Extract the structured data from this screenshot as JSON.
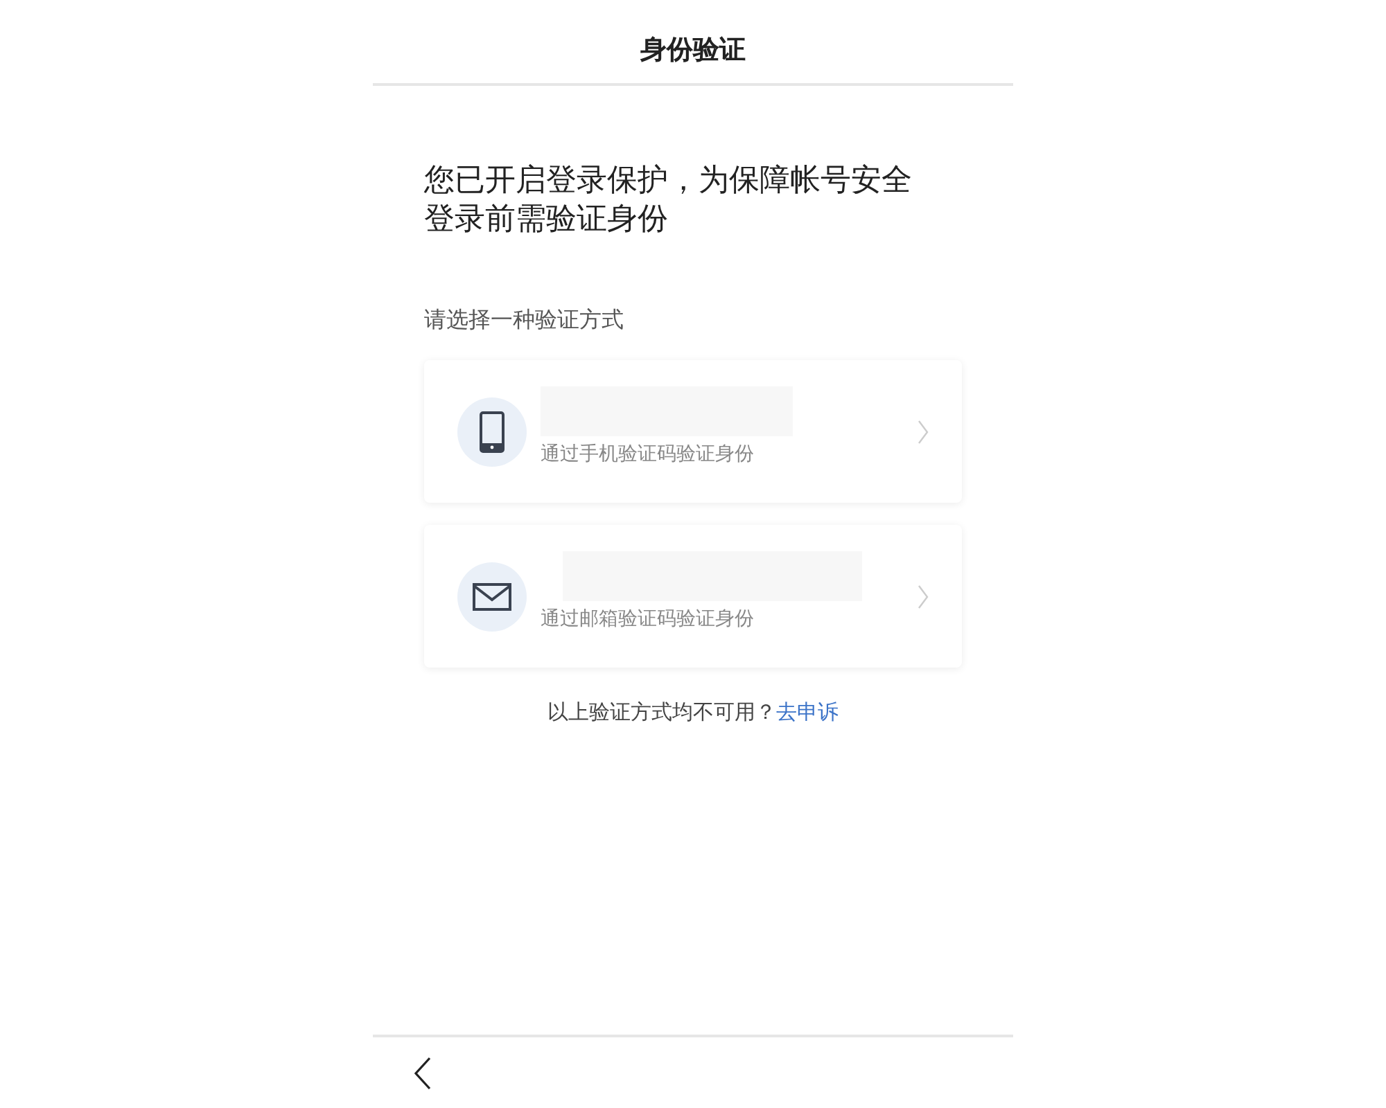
{
  "header": {
    "title": "身份验证"
  },
  "intro": [
    "您已开启登录保护，为保障帐号安全",
    "登录前需验证身份"
  ],
  "prompt": "请选择一种验证方式",
  "methods": [
    {
      "kind": "phone",
      "description": "通过手机验证码验证身份"
    },
    {
      "kind": "mail",
      "description": "通过邮箱验证码验证身份"
    }
  ],
  "footer": {
    "text": "以上验证方式均不可用？",
    "link": "去申诉"
  }
}
